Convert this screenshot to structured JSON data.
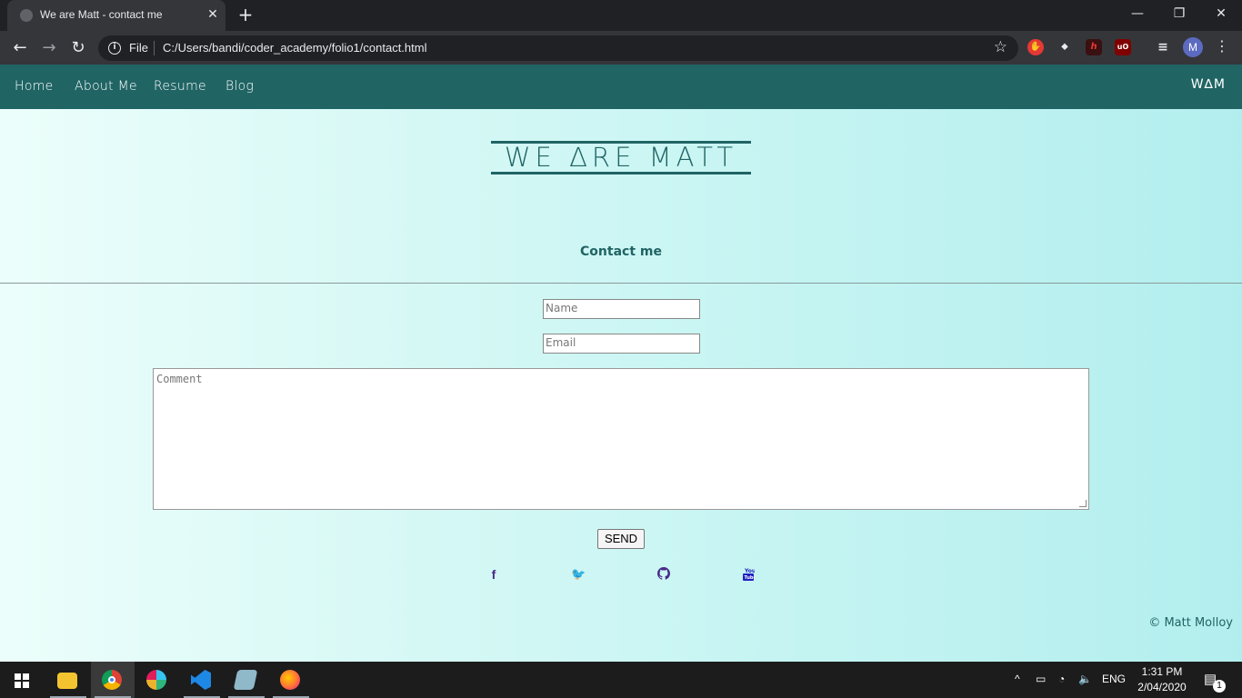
{
  "browser": {
    "tab_title": "We are Matt - contact me",
    "close_glyph": "✕",
    "newtab_glyph": "+",
    "url_scheme": "File",
    "url": "C:/Users/bandi/coder_academy/folio1/contact.html",
    "profile_initial": "M",
    "window_controls": [
      "—",
      "❐",
      "✕"
    ]
  },
  "site": {
    "nav_items": [
      "Home",
      "About Me",
      "Resume",
      "Blog"
    ],
    "nav_logo": "W∆M",
    "hero_title": "WE ∆RE MATT",
    "section_heading": "Contact me",
    "form": {
      "name_placeholder": "Name",
      "email_placeholder": "Email",
      "comment_placeholder": "Comment",
      "send_label": "SEND"
    },
    "social_icons": [
      "facebook-icon",
      "twitter-icon",
      "github-icon",
      "youtube-icon"
    ],
    "copyright": "© Matt Molloy",
    "accent_color": "#206464"
  },
  "taskbar": {
    "language": "ENG",
    "time": "1:31 PM",
    "date": "2/04/2020",
    "notification_count": "1"
  }
}
